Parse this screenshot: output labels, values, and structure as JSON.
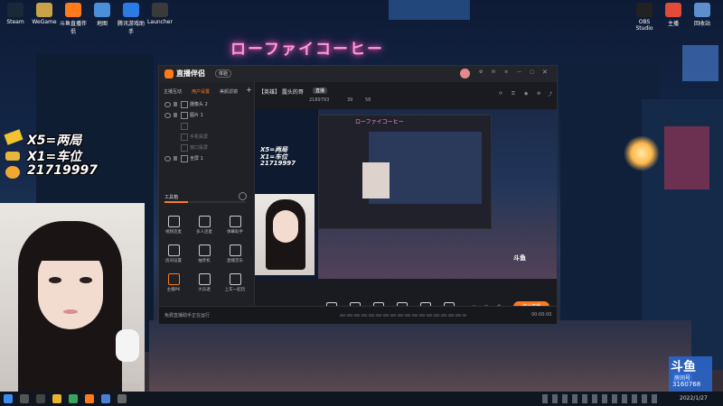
{
  "desktop": {
    "neon_sign": "ローファイコーヒー",
    "icons_left": [
      "Steam",
      "WeGame",
      "斗鱼直播伴侣",
      "地图",
      "腾讯游戏助手",
      "Launcher"
    ],
    "icons_right": [
      "OBS Studio",
      "主播",
      "回收站"
    ]
  },
  "overlay": {
    "line1": "X5=两局",
    "line2": "X1=车位",
    "line3": "21719997"
  },
  "app": {
    "title": "直播伴侣",
    "badge": "体验",
    "sidebar_tabs": [
      "主播互动",
      "用户设置",
      "美颜滤镜"
    ],
    "layers": [
      "摄像头 2",
      "图片 1",
      "",
      "手机投屏",
      "窗口投屏",
      "全屏 1"
    ],
    "toolbox_title": "工具箱",
    "tools": [
      "视频连麦",
      "多人连麦",
      "弹幕助手",
      "房间设置",
      "抽奖机",
      "直播音乐",
      "主播PK",
      "大乐透",
      "上车一起玩"
    ],
    "room_title": "【英雄】 露头的哥",
    "room_tag": "直播",
    "room_stats": [
      "2189793",
      "39",
      "58"
    ],
    "bottom_tools": [
      "直播素材",
      "摄像头",
      "手机投屏",
      "多媒体",
      "麦克风",
      "扬声器"
    ],
    "start_button": "停止直播",
    "status_text": "免费直播助手正在运行",
    "status_time": "00:00:00"
  },
  "watermark": {
    "brand": "斗鱼",
    "room": "房间号",
    "id": "3160768"
  },
  "taskbar": {
    "date": "2022/1/27"
  }
}
